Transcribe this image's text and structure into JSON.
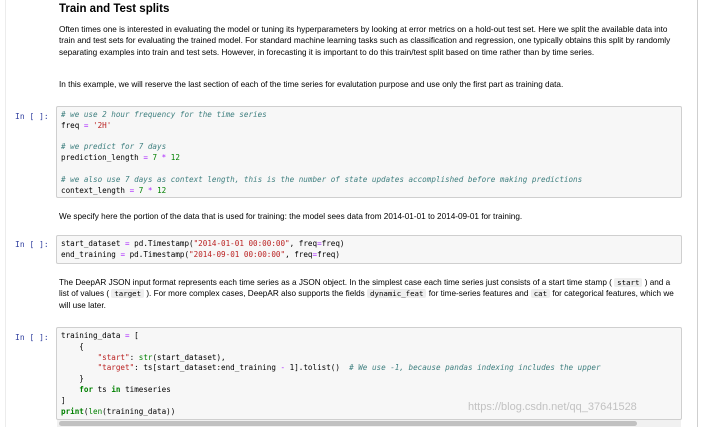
{
  "section": {
    "title": "Train and Test splits",
    "para1": "Often times one is interested in evaluating the model or tuning its hyperparameters by looking at error metrics on a hold-out test set. Here we split the available data into train and test sets for evaluating the trained model. For standard machine learning tasks such as classification and regression, one typically obtains this split by randomly separating examples into train and test sets. However, in forecasting it is important to do this train/test split based on time rather than by time series.",
    "para2": "In this example, we will reserve the last section of each of the time series for evalutation purpose and use only the first part as training data.",
    "para3": "We specify here the portion of the data that is used for training: the model sees data from 2014-01-01 to 2014-09-01 for training.",
    "para4_a": "The DeepAR JSON input format represents each time series as a JSON object. In the simplest case each time series just consists of a start time stamp (",
    "para4_code1": "start",
    "para4_b": ") and a list of values (",
    "para4_code2": "target",
    "para4_c": "). For more complex cases, DeepAR also supports the fields",
    "para4_code3": "dynamic_feat",
    "para4_d": "for time-series features and",
    "para4_code4": "cat",
    "para4_e": "for categorical features, which we will use later."
  },
  "prompts": {
    "p1": "In [ ]:",
    "p2": "In [ ]:",
    "p3": "In [ ]:"
  },
  "cell1": {
    "c1": "# we use 2 hour frequency for the time series",
    "freq_var": "freq",
    "eq": "=",
    "freq_val": "'2H'",
    "c2": "# we predict for 7 days",
    "pl_var": "prediction_length",
    "pl_expr_a": "7",
    "pl_expr_op": "*",
    "pl_expr_b": "12",
    "c3": "# we also use 7 days as context length, this is the number of state updates accomplished before making predictions",
    "cl_var": "context_length",
    "cl_expr_a": "7",
    "cl_expr_op": "*",
    "cl_expr_b": "12"
  },
  "cell2": {
    "l1_a": "start_dataset",
    "l1_b": "pd.Timestamp(",
    "l1_str": "\"2014-01-01 00:00:00\"",
    "l1_c": ", freq",
    "l1_d": "freq)",
    "l2_a": "end_training",
    "l2_b": "pd.Timestamp(",
    "l2_str": "\"2014-09-01 00:00:00\"",
    "l2_c": ", freq",
    "l2_d": "freq)"
  },
  "cell3": {
    "l1": "training_data",
    "l1_b": "[",
    "l2": "{",
    "l3_key": "\"start\"",
    "l3_fn": "str",
    "l3_arg": "(start_dataset),",
    "l4_key": "\"target\"",
    "l4_a": "ts[start_dataset:end_training",
    "l4_op": "-",
    "l4_b": "1].tolist()",
    "l4_comment": "# We use -1, because pandas indexing includes the upper",
    "l5": "}",
    "l6_for": "for",
    "l6_ts": "ts",
    "l6_in": "in",
    "l6_rest": "timeseries",
    "l7": "]",
    "l8_print": "print",
    "l8_a": "(",
    "l8_len": "len",
    "l8_b": "(training_data))"
  },
  "watermark": "https://blog.csdn.net/qq_37641528"
}
